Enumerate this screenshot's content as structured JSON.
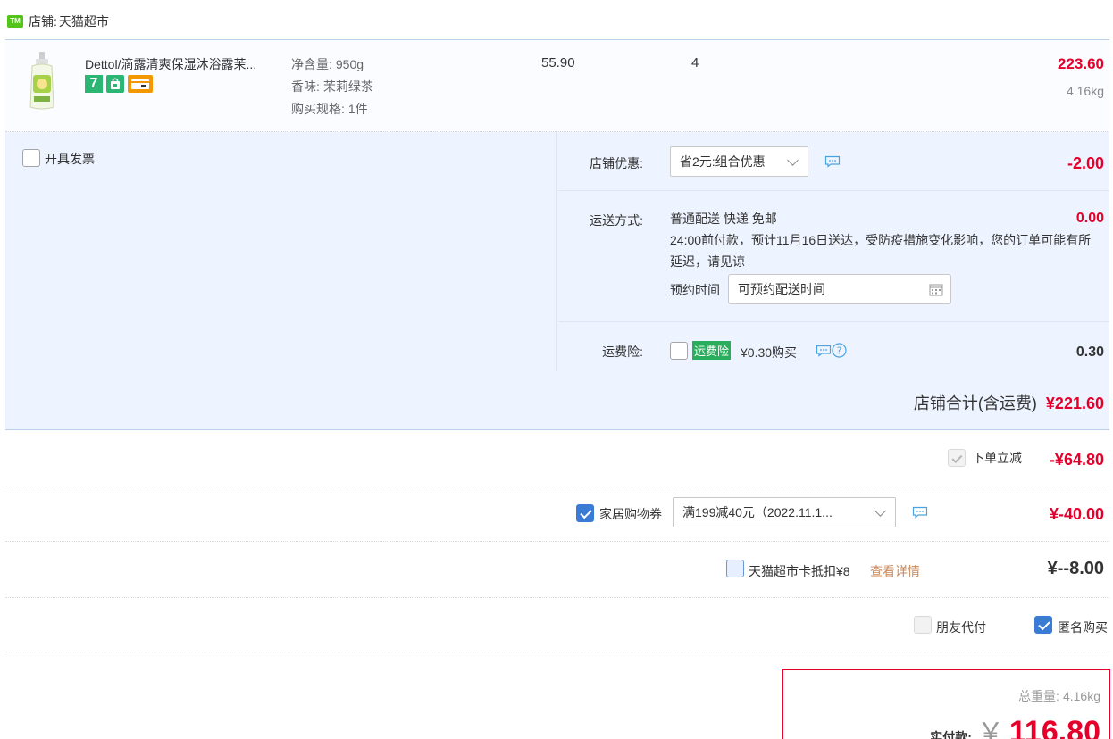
{
  "shop": {
    "prefix_label": "店铺:",
    "name": "天猫超市",
    "icon": "tmall-icon"
  },
  "item": {
    "title": "Dettol/滴露清爽保湿沐浴露茉...",
    "attributes": [
      {
        "key": "净含量:",
        "value": "950g"
      },
      {
        "key": "香味:",
        "value": "茉莉绿茶"
      },
      {
        "key": "购买规格:",
        "value": "1件"
      }
    ],
    "unit_price": "55.90",
    "quantity": "4",
    "subtotal": "223.60",
    "weight": "4.16kg",
    "badges": [
      "seven-day-return-icon",
      "bag-icon",
      "card-icon"
    ],
    "badge7_text": "7"
  },
  "invoice": {
    "label": "开具发票",
    "checked": false
  },
  "store_discount": {
    "label": "店铺优惠:",
    "selected": "省2元:组合优惠",
    "amount": "-2.00"
  },
  "shipping": {
    "label": "运送方式:",
    "method": "普通配送 快递 免邮",
    "note": "24:00前付款，预计11月16日送达，受防疫措施变化影响，您的订单可能有所延迟，请见谅",
    "amount": "0.00",
    "schedule_label": "预约时间",
    "schedule_placeholder": "可预约配送时间"
  },
  "freight_insurance": {
    "label": "运费险:",
    "tag": "运费险",
    "text": "¥0.30购买",
    "amount": "0.30",
    "checked": false
  },
  "store_total": {
    "label": "店铺合计(含运费)",
    "amount": "¥221.60"
  },
  "order_discount": {
    "label": "下单立减",
    "amount": "-¥64.80",
    "checked": true,
    "disabled": true
  },
  "coupon": {
    "label": "家居购物券",
    "selected": "满199减40元（2022.11.1...",
    "amount": "¥-40.00",
    "checked": true
  },
  "card": {
    "label": "天猫超市卡抵扣¥8",
    "link": "查看详情",
    "amount": "¥--8.00",
    "checked": false
  },
  "pay_for_friend": {
    "label": "朋友代付",
    "checked": false
  },
  "anonymous": {
    "label": "匿名购买",
    "checked": true
  },
  "summary": {
    "weight_label": "总重量:",
    "weight": "4.16kg",
    "pay_label": "实付款:",
    "currency": "￥",
    "amount": "116.80"
  },
  "colors": {
    "accent_red": "#e4002b",
    "check_blue": "#3a7bd5",
    "panel_bg": "#eef4ff",
    "tmall_green": "#2aae5e"
  }
}
